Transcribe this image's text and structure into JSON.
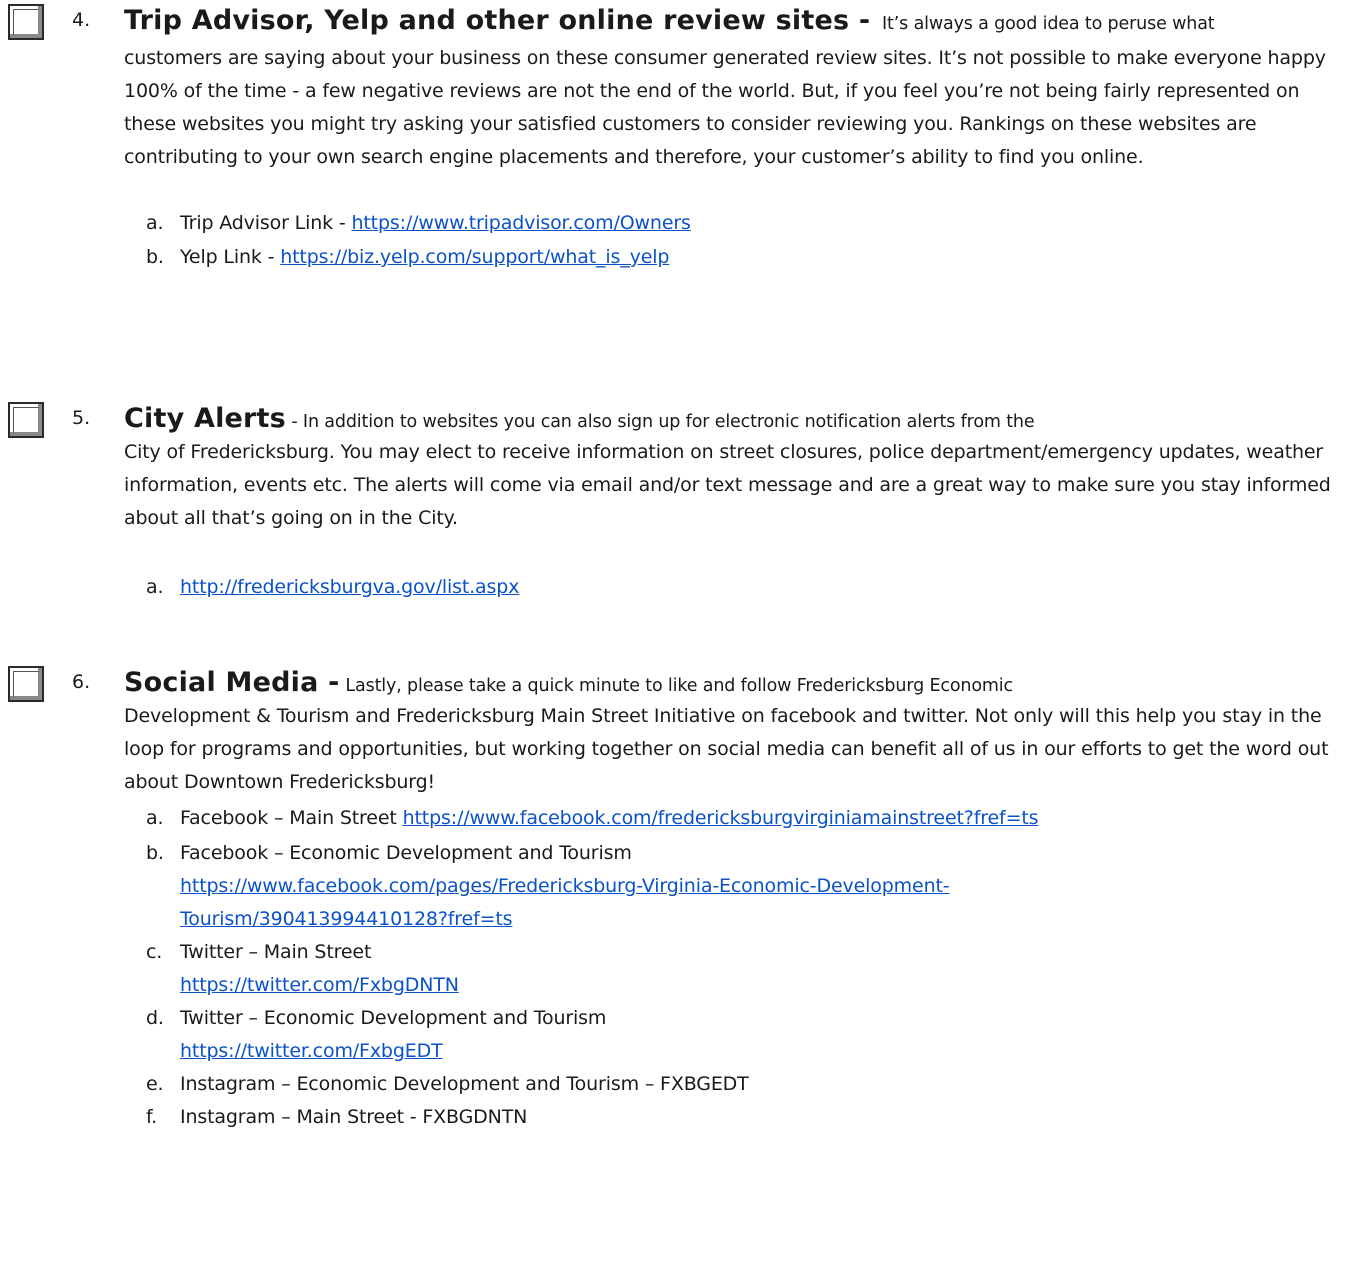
{
  "sections": [
    {
      "number": "4.",
      "heading": "Trip Advisor, Yelp and other online review sites -",
      "intro": "It’s always a good idea to peruse what",
      "text": "customers are saying about your business on these consumer generated review sites.  It’s not possible to make everyone happy 100% of the time - a few negative reviews are not the end of the world.  But, if you feel you’re not being fairly represented on these websites you might try asking your satisfied customers to consider reviewing you.  Rankings on these websites are contributing to your own search engine placements and therefore, your customer’s ability to find you online.",
      "items": [
        {
          "letter": "a.",
          "label": "Trip Advisor Link - ",
          "url": "https://www.tripadvisor.com/Owners"
        },
        {
          "letter": "b.",
          "label": "Yelp Link - ",
          "url": "https://biz.yelp.com/support/what_is_yelp"
        }
      ]
    },
    {
      "number": "5.",
      "heading": "City Alerts",
      "intro": " - In addition to websites you can also sign up for electronic notification alerts from the",
      "text": "City of Fredericksburg.  You may elect to receive information on street closures, police department/emergency updates, weather information, events etc.  The alerts will come via email and/or text message and are a great way to make sure you stay informed about all that’s going on in the City.",
      "items": [
        {
          "letter": "a.",
          "label": "",
          "url": "http://fredericksburgva.gov/list.aspx"
        }
      ]
    },
    {
      "number": "6.",
      "heading": "Social Media -",
      "intro": "Lastly, please take a quick minute to like and follow Fredericksburg Economic",
      "text": "Development & Tourism and Fredericksburg Main Street Initiative on facebook and twitter.   Not only will this help you stay in the loop for programs and opportunities, but working together on social media can benefit all of us in our efforts to get the word out about Downtown Fredericksburg!",
      "items": [
        {
          "letter": "a.",
          "label": "Facebook – Main Street ",
          "url": "https://www.facebook.com/fredericksburgvirginiamainstreet?fref=ts"
        },
        {
          "letter": "b.",
          "label": "Facebook – Economic Development and Tourism",
          "url_line1": "https://www.facebook.com/pages/Fredericksburg-Virginia-Economic-Development-",
          "url_line2": "Tourism/390413994410128?fref=ts"
        },
        {
          "letter": "c.",
          "label": "Twitter – Main Street",
          "url": "https://twitter.com/FxbgDNTN"
        },
        {
          "letter": "d.",
          "label": "Twitter – Economic Development and Tourism",
          "url": "https://twitter.com/FxbgEDT"
        },
        {
          "letter": "e.",
          "label": "Instagram – Economic Development and Tourism – FXBGEDT"
        },
        {
          "letter": "f.",
          "label": "Instagram – Main Street - FXBGDNTN"
        }
      ]
    }
  ]
}
